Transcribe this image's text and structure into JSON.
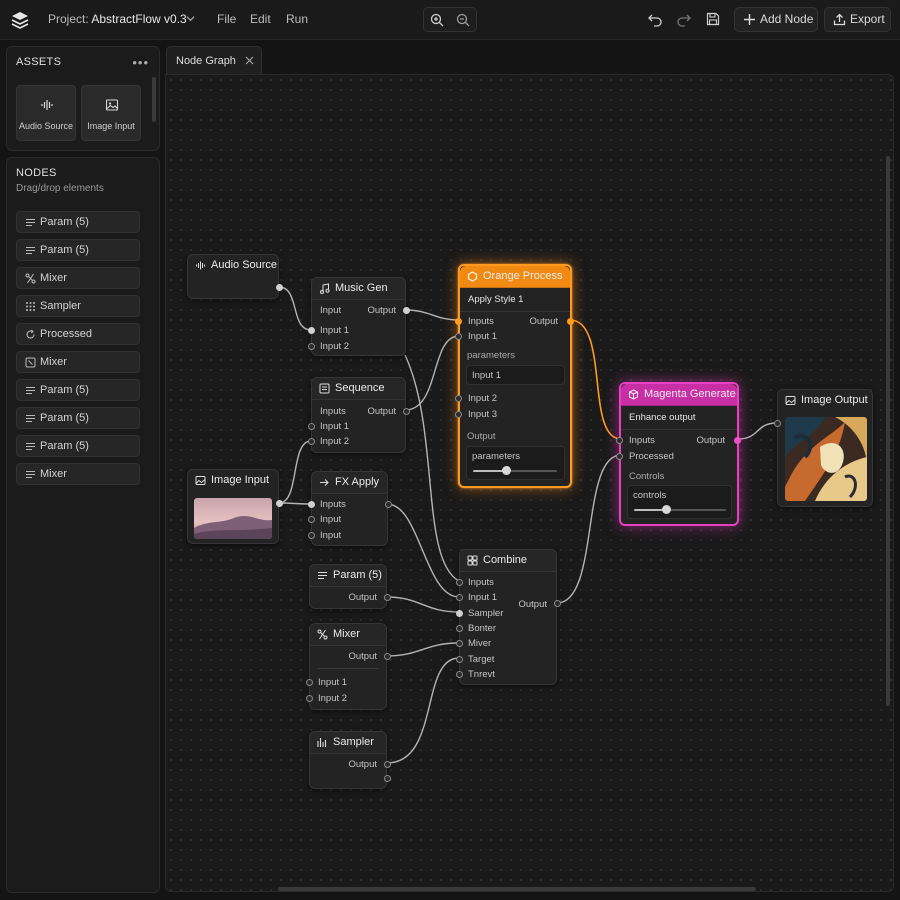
{
  "toolbar": {
    "project_prefix": "Project: ",
    "project_name": "AbstractFlow v0.3",
    "menus": [
      "File",
      "Edit",
      "Run"
    ],
    "add_node_label": "Add Node",
    "export_label": "Export"
  },
  "assets": {
    "title": "ASSETS",
    "items": [
      "Audio Source",
      "Image Input"
    ]
  },
  "nodes_panel": {
    "title": "NODES",
    "subtitle": "Drag/drop elements",
    "items": [
      "Param (5)",
      "Param (5)",
      "Mixer",
      "Sampler",
      "Processed",
      "Mixer",
      "Param (5)",
      "Param (5)",
      "Param (5)",
      "Mixer"
    ]
  },
  "tab": {
    "label": "Node Graph"
  },
  "graph": {
    "audio_source": {
      "title": "Audio Source"
    },
    "music_gen": {
      "title": "Music Gen",
      "input": "Input",
      "output": "Output",
      "in1": "Input 1",
      "in2": "Input 2"
    },
    "sequence": {
      "title": "Sequence",
      "inputs": "Inputs",
      "output": "Output",
      "in1": "Input 1",
      "in2": "Input 2"
    },
    "image_input": {
      "title": "Image Input"
    },
    "fx_apply": {
      "title": "FX Apply",
      "inputs": "Inputs",
      "in_a": "Input",
      "in_b": "Input"
    },
    "param": {
      "title": "Param (5)",
      "output": "Output"
    },
    "mixer": {
      "title": "Mixer",
      "output": "Output",
      "in1": "Input 1",
      "in2": "Input 2"
    },
    "sampler": {
      "title": "Sampler",
      "output": "Output"
    },
    "orange_process": {
      "title": "Orange Process",
      "subtitle": "Apply Style 1",
      "inputs": "Inputs",
      "output": "Output",
      "in1": "Input 1",
      "params_label": "parameters",
      "field_value": "Input 1",
      "in2": "Input 2",
      "in3": "Input 3",
      "output_section": "Output",
      "slider_label": "parameters",
      "slider_value": 0.4,
      "accent": "#ff9a1f"
    },
    "magenta_generate": {
      "title": "Magenta Generate",
      "subtitle": "Enhance output",
      "inputs": "Inputs",
      "output": "Output",
      "processed": "Processed",
      "controls_section": "Controls",
      "slider_label": "controls",
      "slider_value": 0.35,
      "accent": "#e93fc3"
    },
    "combine": {
      "title": "Combine",
      "inputs": [
        "Inputs",
        "Input 1",
        "Sampler",
        "Bonter",
        "Miver",
        "Target",
        "Tnrevt"
      ],
      "output": "Output"
    },
    "image_output": {
      "title": "Image Output"
    }
  }
}
